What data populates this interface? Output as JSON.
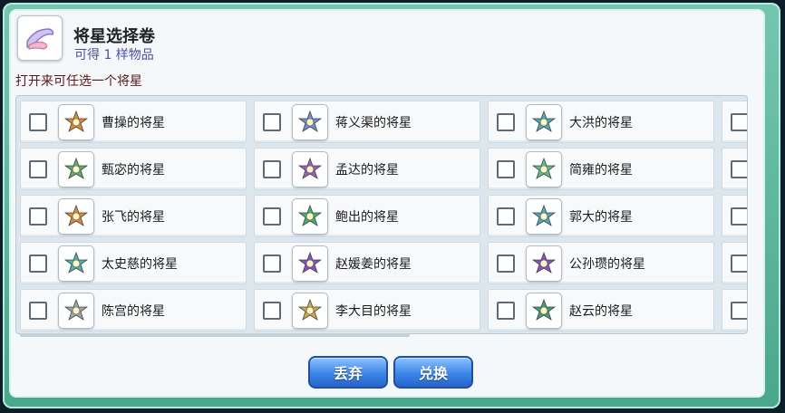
{
  "scroll": {
    "title": "将星选择卷",
    "subtitle": "可得 1 样物品",
    "prompt": "打开来可任选一个将星"
  },
  "items": [
    [
      {
        "name": "曹操的将星",
        "icon": "orange-sun-star-icon",
        "color": "#e08a2a"
      },
      {
        "name": "蒋义渠的将星",
        "icon": "blue-cross-star-icon",
        "color": "#6a8fd8"
      },
      {
        "name": "大洪的将星",
        "icon": "teal-knot-star-icon",
        "color": "#4aa9b8"
      }
    ],
    [
      {
        "name": "甄宓的将星",
        "icon": "green-cross-star-icon",
        "color": "#5bb36a"
      },
      {
        "name": "孟达的将星",
        "icon": "purple-swirl-star-icon",
        "color": "#a05cc6"
      },
      {
        "name": "简雍的将星",
        "icon": "green-leaf-star-icon",
        "color": "#5bbf8c"
      }
    ],
    [
      {
        "name": "张飞的将星",
        "icon": "orange-sun-star-icon",
        "color": "#e08a2a"
      },
      {
        "name": "鲍出的将星",
        "icon": "green-orb-star-icon",
        "color": "#3fb36a"
      },
      {
        "name": "郭大的将星",
        "icon": "teal-knot-star-icon",
        "color": "#4aa9b8"
      }
    ],
    [
      {
        "name": "太史慈的将星",
        "icon": "teal-star-icon",
        "color": "#48b4b0"
      },
      {
        "name": "赵媛姜的将星",
        "icon": "purple-star-icon",
        "color": "#8a4ec8"
      },
      {
        "name": "公孙瓒的将星",
        "icon": "purple-star-icon",
        "color": "#8a4ec8"
      }
    ],
    [
      {
        "name": "陈宫的将星",
        "icon": "silver-ring-star-icon",
        "color": "#9aa6a8"
      },
      {
        "name": "李大目的将星",
        "icon": "gold-orb-star-icon",
        "color": "#d4a83a"
      },
      {
        "name": "赵云的将星",
        "icon": "green-diamond-star-icon",
        "color": "#3c9e7a"
      }
    ]
  ],
  "buttons": {
    "discard": "丢弃",
    "exchange": "兑换"
  },
  "colors": {
    "frame": "#5cb79d",
    "button": "#3b86e8",
    "title": "#222222",
    "subtitle": "#4d4fb0",
    "prompt": "#5a1818"
  }
}
